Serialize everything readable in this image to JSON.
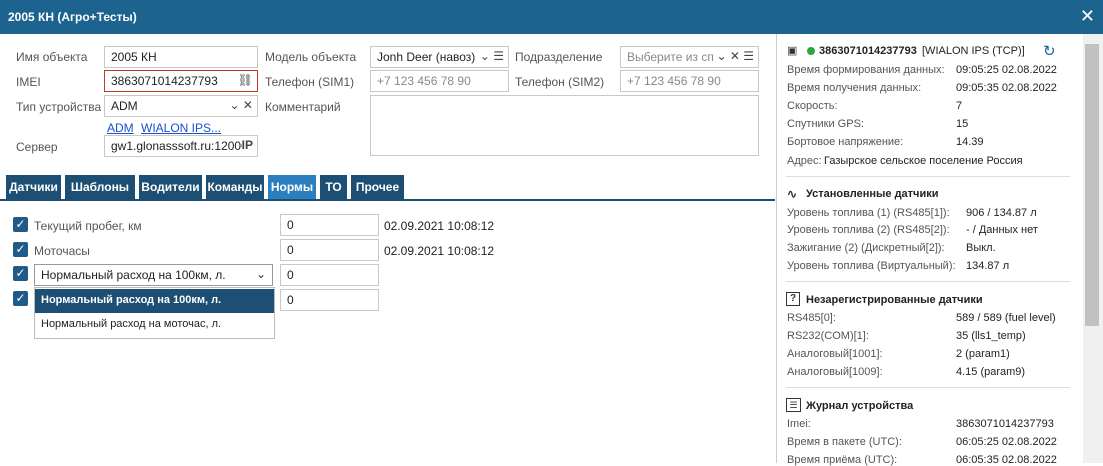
{
  "window": {
    "title": "2005 КН (Агро+Тесты)",
    "close_icon": "close-icon"
  },
  "form": {
    "name_label": "Имя объекта",
    "name_value": "2005 КН",
    "imei_label": "IMEI",
    "imei_value": "3863071014237793",
    "device_type_label": "Тип устройства",
    "device_type_value": "ADM",
    "link_adm": "ADM",
    "link_wialon": "WIALON IPS...",
    "server_label": "Сервер",
    "server_value": "gw1.glonasssoft.ru:12000",
    "server_badge": "IP",
    "model_label": "Модель объекта",
    "model_value": "Jonh Deer (навоз)",
    "phone1_label": "Телефон (SIM1)",
    "phone1_placeholder": "+7 123 456 78 90",
    "comment_label": "Комментарий",
    "division_label": "Подразделение",
    "division_placeholder": "Выберите из сп",
    "phone2_label": "Телефон (SIM2)",
    "phone2_placeholder": "+7 123 456 78 90"
  },
  "tabs": [
    "Датчики",
    "Шаблоны",
    "Водители",
    "Команды",
    "Нормы",
    "ТО",
    "Прочее"
  ],
  "active_tab": "Нормы",
  "norms": {
    "row1_label": "Текущий пробег, км",
    "row1_value": "0",
    "row1_date": "02.09.2021 10:08:12",
    "row2_label": "Моточасы",
    "row2_value": "0",
    "row2_date": "02.09.2021 10:08:12",
    "row3_select": "Нормальный расход на 100км, л.",
    "row3_value": "0",
    "row4_value": "0",
    "dropdown_options": [
      "Нормальный расход на 100км, л.",
      "Нормальный расход на моточас, л."
    ]
  },
  "device": {
    "id": "3863071014237793",
    "protocol": "[WIALON IPS (TCP)]",
    "status_color": "#27a844",
    "rows": [
      {
        "label": "Время формирования данных:",
        "value": "09:05:25 02.08.2022"
      },
      {
        "label": "Время получения данных:",
        "value": "09:05:35 02.08.2022"
      },
      {
        "label": "Скорость:",
        "value": "7"
      },
      {
        "label": "Спутники GPS:",
        "value": "15"
      },
      {
        "label": "Бортовое напряжение:",
        "value": "14.39"
      }
    ],
    "address_label": "Адрес:",
    "address_value": "Газырское сельское поселение Россия"
  },
  "installed": {
    "title": "Установленные датчики",
    "rows": [
      {
        "label": "Уровень топлива (1) (RS485[1]):",
        "value": "906 / 134.87 л"
      },
      {
        "label": "Уровень топлива (2) (RS485[2]):",
        "value": "- / Данных нет"
      },
      {
        "label": "Зажигание (2) (Дискретный[2]):",
        "value": "Выкл."
      },
      {
        "label": "Уровень топлива (Виртуальный):",
        "value": "134.87 л"
      }
    ]
  },
  "unregistered": {
    "title": "Незарегистрированные датчики",
    "rows": [
      {
        "label": "RS485[0]:",
        "value": "589 / 589 (fuel level)"
      },
      {
        "label": "RS232(COM)[1]:",
        "value": "35 (lls1_temp)"
      },
      {
        "label": "Аналоговый[1001]:",
        "value": "2 (param1)"
      },
      {
        "label": "Аналоговый[1009]:",
        "value": "4.15 (param9)"
      }
    ]
  },
  "journal": {
    "title": "Журнал устройства",
    "rows": [
      {
        "label": "Imei:",
        "value": "3863071014237793"
      },
      {
        "label": "Время в пакете (UTC):",
        "value": "06:05:25 02.08.2022"
      },
      {
        "label": "Время приёма (UTC):",
        "value": "06:05:35 02.08.2022"
      }
    ]
  }
}
